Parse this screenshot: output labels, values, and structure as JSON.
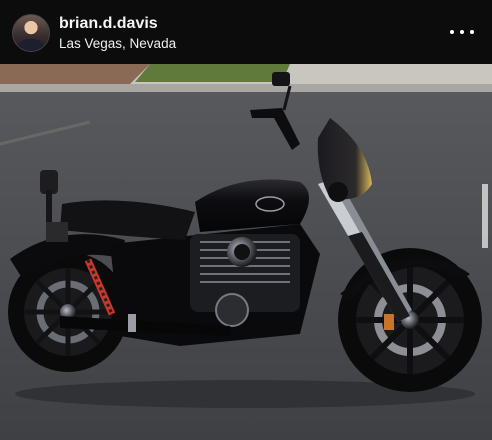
{
  "post": {
    "username": "brian.d.davis",
    "location": "Las Vegas, Nevada",
    "more_icon": "more-horizontal-icon"
  },
  "photo": {
    "subject_icon": "motorcycle",
    "motorcycle_color": "#0b0b0d",
    "road_color": "#4a4b4f",
    "sidewalk_color": "#c9c6c0",
    "lawn_color": "#5f7a3b",
    "dirt_color": "#8a6a55",
    "fairing_tint": "#d8b85a"
  },
  "theme": {
    "header_bg": "#0c0c0c",
    "text_color": "#f5f5f5"
  }
}
